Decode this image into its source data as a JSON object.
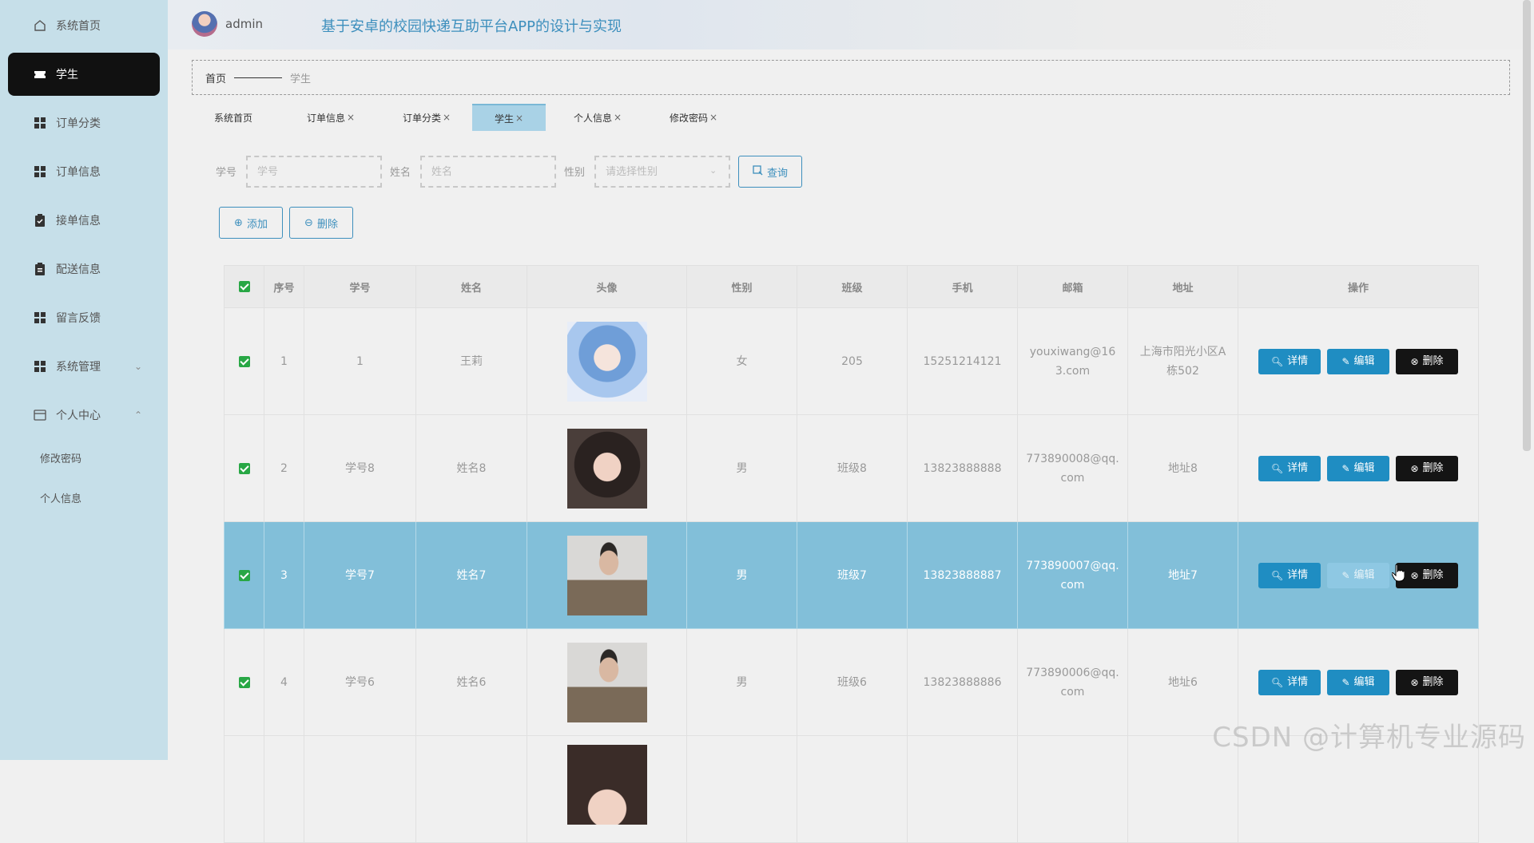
{
  "header": {
    "username": "admin",
    "app_title": "基于安卓的校园快递互助平台APP的设计与实现"
  },
  "sidebar": {
    "items": [
      {
        "label": "系统首页",
        "icon": "home-icon"
      },
      {
        "label": "学生",
        "icon": "ticket-icon",
        "active": true
      },
      {
        "label": "订单分类",
        "icon": "grid-icon"
      },
      {
        "label": "订单信息",
        "icon": "grid-icon"
      },
      {
        "label": "接单信息",
        "icon": "clipboard-icon"
      },
      {
        "label": "配送信息",
        "icon": "clipboard-icon"
      },
      {
        "label": "留言反馈",
        "icon": "grid-icon"
      },
      {
        "label": "系统管理",
        "icon": "grid-icon",
        "expandable": true
      },
      {
        "label": "个人中心",
        "icon": "calendar-icon",
        "expanded": true
      }
    ],
    "sub_items": [
      {
        "label": "修改密码"
      },
      {
        "label": "个人信息"
      }
    ]
  },
  "breadcrumb": {
    "home": "首页",
    "current": "学生"
  },
  "tabs": [
    {
      "label": "系统首页",
      "closable": false
    },
    {
      "label": "订单信息",
      "closable": true
    },
    {
      "label": "订单分类",
      "closable": true
    },
    {
      "label": "学生",
      "closable": true,
      "active": true
    },
    {
      "label": "个人信息",
      "closable": true
    },
    {
      "label": "修改密码",
      "closable": true
    }
  ],
  "tab_close": "×",
  "search": {
    "id_label": "学号",
    "id_placeholder": "学号",
    "name_label": "姓名",
    "name_placeholder": "姓名",
    "gender_label": "性别",
    "gender_placeholder": "请选择性别",
    "query_button": "查询"
  },
  "actions": {
    "add": "添加",
    "delete": "删除"
  },
  "table": {
    "columns": [
      "序号",
      "学号",
      "姓名",
      "头像",
      "性别",
      "班级",
      "手机",
      "邮箱",
      "地址",
      "操作"
    ],
    "rows": [
      {
        "index": "1",
        "student_id": "1",
        "name": "王莉",
        "avatar": "anime",
        "gender": "女",
        "class": "205",
        "phone": "15251214121",
        "email": "youxiwang@163.com",
        "address": "上海市阳光小区A栋502"
      },
      {
        "index": "2",
        "student_id": "学号8",
        "name": "姓名8",
        "avatar": "girl",
        "gender": "男",
        "class": "班级8",
        "phone": "13823888888",
        "email": "773890008@qq.com",
        "address": "地址8"
      },
      {
        "index": "3",
        "student_id": "学号7",
        "name": "姓名7",
        "avatar": "boy",
        "gender": "男",
        "class": "班级7",
        "phone": "13823888887",
        "email": "773890007@qq.com",
        "address": "地址7",
        "highlighted": true
      },
      {
        "index": "4",
        "student_id": "学号6",
        "name": "姓名6",
        "avatar": "boy",
        "gender": "男",
        "class": "班级6",
        "phone": "13823888886",
        "email": "773890006@qq.com",
        "address": "地址6"
      }
    ],
    "row_actions": {
      "detail": "详情",
      "edit": "编辑",
      "delete": "删除"
    }
  },
  "watermark": "CSDN @计算机专业源码",
  "colors": {
    "sidebar_bg": "#c6dfe9",
    "active_nav": "#111111",
    "primary": "#1f8dc2",
    "highlight_row": "#82bfd9",
    "checkbox": "#28a745"
  }
}
